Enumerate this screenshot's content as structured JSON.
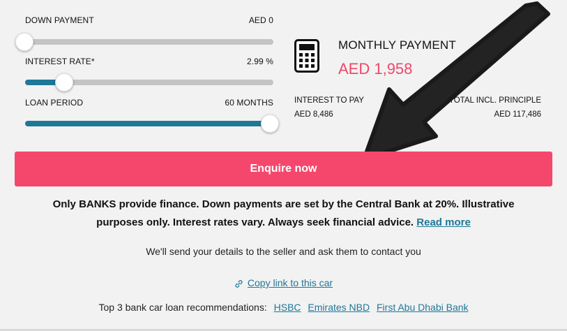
{
  "sliders": {
    "down_payment": {
      "label": "DOWN PAYMENT",
      "value": "AED 0",
      "level": 0.0
    },
    "interest_rate": {
      "label": "INTEREST RATE*",
      "value": "2.99 %",
      "level": 0.16
    },
    "loan_period": {
      "label": "LOAN PERIOD",
      "value": "60 MONTHS",
      "level": 1.0
    }
  },
  "summary": {
    "monthly_label": "MONTHLY PAYMENT",
    "monthly_value": "AED 1,958",
    "interest_label": "INTEREST TO PAY",
    "interest_value": "AED 8,486",
    "total_label": "TOTAL INCL. PRINCIPLE",
    "total_value": "AED 117,486"
  },
  "enquire_button": "Enquire now",
  "disclaimer": {
    "text": "Only BANKS provide finance. Down payments are set by the Central Bank at 20%. Illustrative purposes only. Interest rates vary. Always seek financial advice.",
    "read_more": "Read more"
  },
  "send_note": "We'll send your details to the seller and ask them to contact you",
  "copy_link": "Copy link to this car",
  "banks": {
    "prefix": "Top 3 bank car loan recommendations:",
    "items": [
      "HSBC",
      "Emirates NBD",
      "First Abu Dhabi Bank"
    ]
  },
  "icons": {
    "calculator": "calculator-icon",
    "link": "link-icon",
    "arrow": "arrow-annotation"
  },
  "colors": {
    "accent": "#f5476c",
    "price": "#f0476a",
    "link": "#1e7898",
    "track_fill": "#1e7898"
  }
}
